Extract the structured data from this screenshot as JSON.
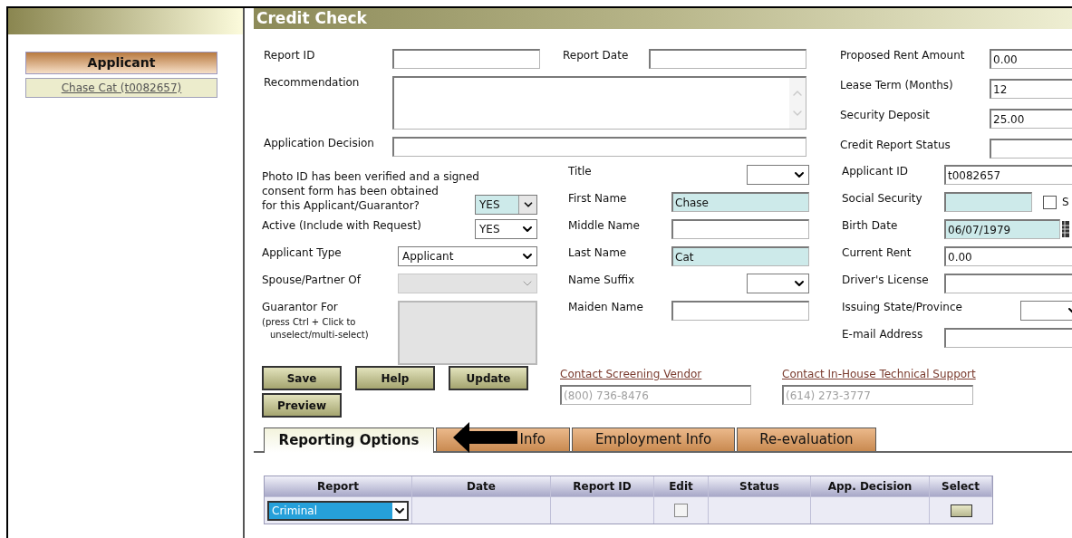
{
  "sidebar": {
    "heading": "Applicant",
    "items": [
      {
        "label": "Chase Cat (t0082657)"
      }
    ]
  },
  "title": "Credit Check",
  "top_left": [
    {
      "kind": "text",
      "label": "Report ID"
    },
    {
      "kind": "text",
      "label": "Report Date"
    },
    {
      "kind": "textarea",
      "label": "Recommendation"
    },
    {
      "kind": "text",
      "label": "Application Decision"
    }
  ],
  "top_right": [
    {
      "label": "Proposed Rent Amount",
      "value": "0.00"
    },
    {
      "label": "Lease Term (Months)",
      "value": "12"
    },
    {
      "label": "Security Deposit",
      "value": "25.00"
    },
    {
      "label": "Credit Report Status"
    }
  ],
  "consent": {
    "lines": [
      "Photo ID has been verified and a signed",
      "consent form has been obtained",
      "for this Applicant/Guarantor?"
    ],
    "value": "YES",
    "highlighted": true
  },
  "column_a": [
    {
      "kind": "small-select",
      "label": "Active (Include with Request)",
      "value": "YES",
      "disabled": false
    },
    {
      "kind": "select",
      "label": "Applicant Type",
      "value": "Applicant",
      "disabled": false
    },
    {
      "kind": "select",
      "label": "Spouse/Partner Of",
      "disabled": true
    },
    {
      "kind": "listbox",
      "label": "Guarantor For",
      "hint": [
        "(press Ctrl + Click to",
        "unselect/multi-select)"
      ],
      "disabled": true
    }
  ],
  "column_b": [
    {
      "kind": "small-select",
      "label": "Title",
      "highlighted": false
    },
    {
      "kind": "text",
      "label": "First Name",
      "value": "Chase",
      "highlighted": true
    },
    {
      "kind": "text",
      "label": "Middle Name",
      "highlighted": false
    },
    {
      "kind": "text",
      "label": "Last Name",
      "value": "Cat",
      "highlighted": true
    },
    {
      "kind": "small-select",
      "label": "Name Suffix",
      "highlighted": false
    },
    {
      "kind": "text",
      "label": "Maiden Name",
      "highlighted": false
    }
  ],
  "column_c": [
    {
      "kind": "text",
      "label": "Applicant ID",
      "value": "t0082657",
      "highlighted": false
    },
    {
      "kind": "text-check",
      "label": "Social Security",
      "highlighted": true,
      "check": {
        "label": "S",
        "checked": false
      }
    },
    {
      "kind": "date",
      "label": "Birth Date",
      "value": "06/07/1979",
      "highlighted": true
    },
    {
      "kind": "text",
      "label": "Current Rent",
      "value": "0.00",
      "highlighted": false
    },
    {
      "kind": "text",
      "label": "Driver's License",
      "highlighted": false
    },
    {
      "kind": "small-select",
      "label": "Issuing State/Province",
      "highlighted": false
    },
    {
      "kind": "text",
      "label": "E-mail Address",
      "highlighted": false
    }
  ],
  "buttons": [
    "Save",
    "Help",
    "Update",
    "Preview"
  ],
  "contacts": [
    {
      "link": "Contact Screening Vendor",
      "phone": "(800) 736-8476"
    },
    {
      "link": "Contact In-House Technical Support",
      "phone": "(614) 273-3777"
    }
  ],
  "tabs": [
    {
      "label": "Reporting Options",
      "selected": true
    },
    {
      "label": "Info",
      "selected": false
    },
    {
      "label": "Employment Info",
      "selected": false
    },
    {
      "label": "Re-evaluation",
      "selected": false
    }
  ],
  "table": {
    "columns": [
      "Report",
      "Date",
      "Report ID",
      "Edit",
      "Status",
      "App. Decision",
      "Select"
    ],
    "rows": [
      {
        "report": "Criminal",
        "edit": false
      }
    ]
  }
}
